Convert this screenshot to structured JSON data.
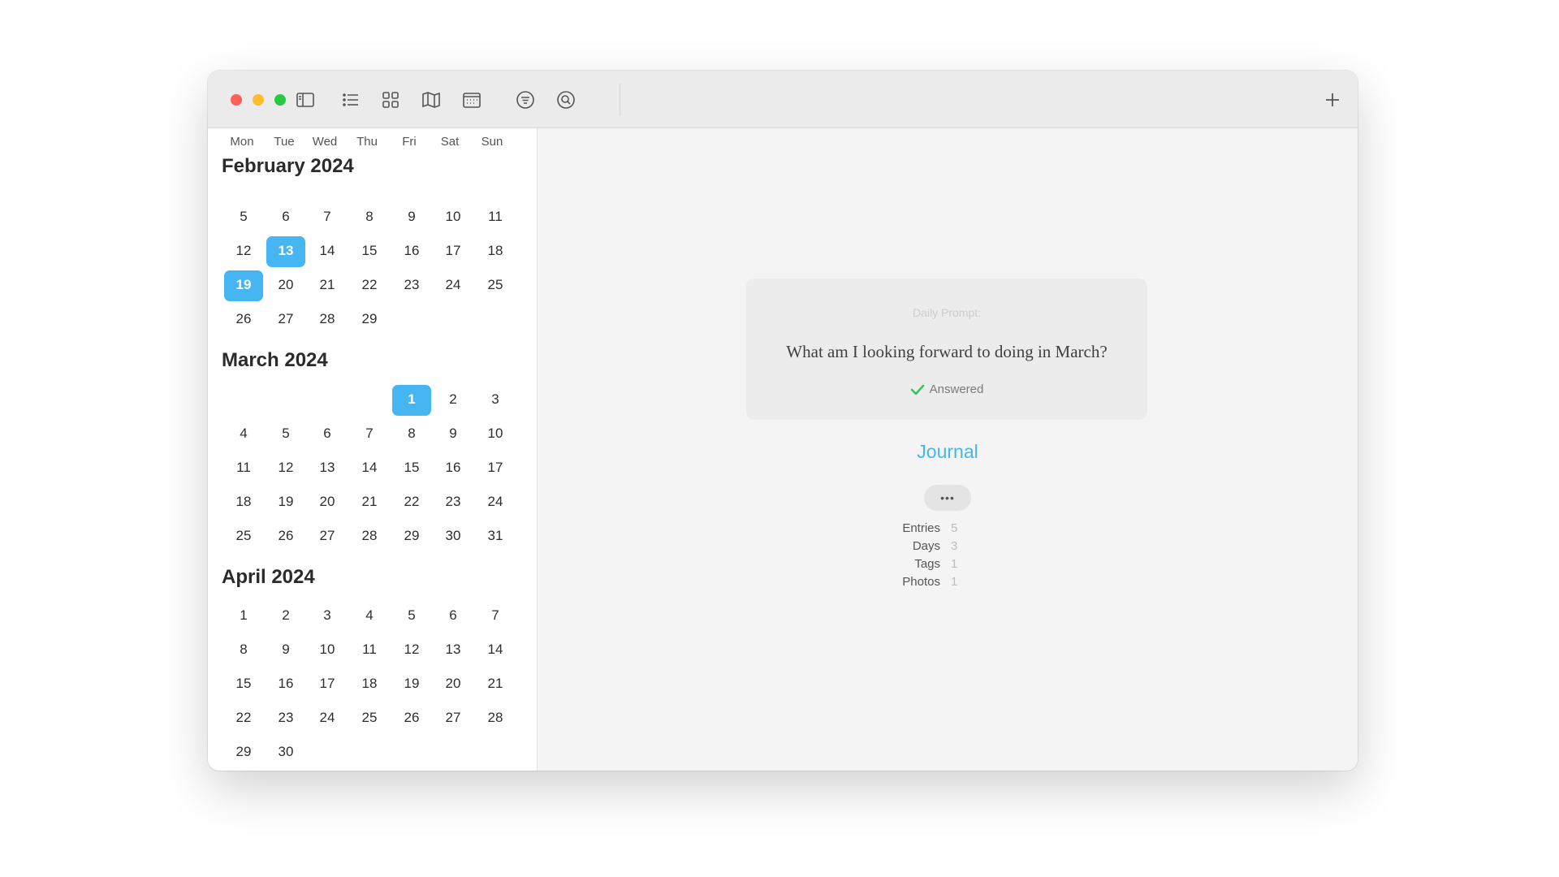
{
  "toolbar": {
    "icons": [
      "sidebar-toggle-icon",
      "list-view-icon",
      "grid-view-icon",
      "map-view-icon",
      "calendar-view-icon",
      "filter-icon",
      "search-icon",
      "add-icon"
    ],
    "add_label": "+"
  },
  "calendar": {
    "weekdays": [
      "Mon",
      "Tue",
      "Wed",
      "Thu",
      "Fri",
      "Sat",
      "Sun"
    ],
    "selection_color": "#45b6f2",
    "months": [
      {
        "title": "February 2024",
        "weeks": [
          [
            "5",
            "6",
            "7",
            "8",
            "9",
            "10",
            "11"
          ],
          [
            "12",
            "13",
            "14",
            "15",
            "16",
            "17",
            "18"
          ],
          [
            "19",
            "20",
            "21",
            "22",
            "23",
            "24",
            "25"
          ],
          [
            "26",
            "27",
            "28",
            "29",
            "",
            "",
            ""
          ]
        ],
        "selected": [
          "13",
          "19"
        ]
      },
      {
        "title": "March 2024",
        "weeks": [
          [
            "",
            "",
            "",
            "",
            "1",
            "2",
            "3"
          ],
          [
            "4",
            "5",
            "6",
            "7",
            "8",
            "9",
            "10"
          ],
          [
            "11",
            "12",
            "13",
            "14",
            "15",
            "16",
            "17"
          ],
          [
            "18",
            "19",
            "20",
            "21",
            "22",
            "23",
            "24"
          ],
          [
            "25",
            "26",
            "27",
            "28",
            "29",
            "30",
            "31"
          ]
        ],
        "selected": [
          "1"
        ]
      },
      {
        "title": "April 2024",
        "weeks": [
          [
            "1",
            "2",
            "3",
            "4",
            "5",
            "6",
            "7"
          ],
          [
            "8",
            "9",
            "10",
            "11",
            "12",
            "13",
            "14"
          ],
          [
            "15",
            "16",
            "17",
            "18",
            "19",
            "20",
            "21"
          ],
          [
            "22",
            "23",
            "24",
            "25",
            "26",
            "27",
            "28"
          ],
          [
            "29",
            "30",
            "",
            "",
            "",
            "",
            ""
          ]
        ],
        "selected": []
      }
    ]
  },
  "prompt": {
    "label": "Daily Prompt:",
    "question": "What am I looking forward to doing in March?",
    "status": "Answered"
  },
  "journal": {
    "title": "Journal",
    "more_label": "•••",
    "stats": [
      {
        "label": "Entries",
        "value": "5"
      },
      {
        "label": "Days",
        "value": "3"
      },
      {
        "label": "Tags",
        "value": "1"
      },
      {
        "label": "Photos",
        "value": "1"
      }
    ]
  }
}
